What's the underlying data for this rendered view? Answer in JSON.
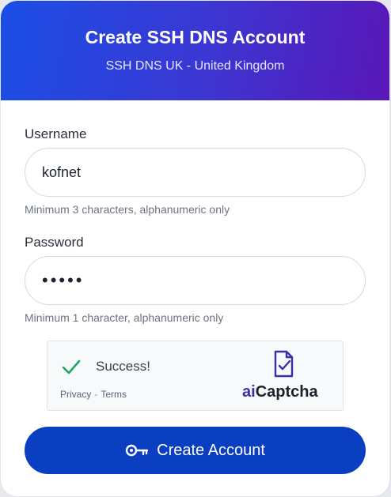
{
  "header": {
    "title": "Create SSH DNS Account",
    "subtitle": "SSH DNS UK - United Kingdom"
  },
  "form": {
    "username": {
      "label": "Username",
      "value": "kofnet",
      "hint": "Minimum 3 characters, alphanumeric only"
    },
    "password": {
      "label": "Password",
      "value": "•••••",
      "hint": "Minimum 1 character, alphanumeric only"
    }
  },
  "captcha": {
    "status": "Success!",
    "privacy_label": "Privacy",
    "separator": "-",
    "terms_label": "Terms",
    "brand_prefix": "ai",
    "brand_suffix": "Captcha",
    "check_icon": "check-icon",
    "logo_icon": "captcha-document-icon"
  },
  "submit": {
    "label": "Create Account",
    "icon": "key-icon"
  },
  "colors": {
    "header_gradient_start": "#1a4fe6",
    "header_gradient_end": "#5a17b8",
    "button": "#0b3fc2",
    "check": "#1fa564",
    "brand_accent": "#3b2ea8"
  }
}
